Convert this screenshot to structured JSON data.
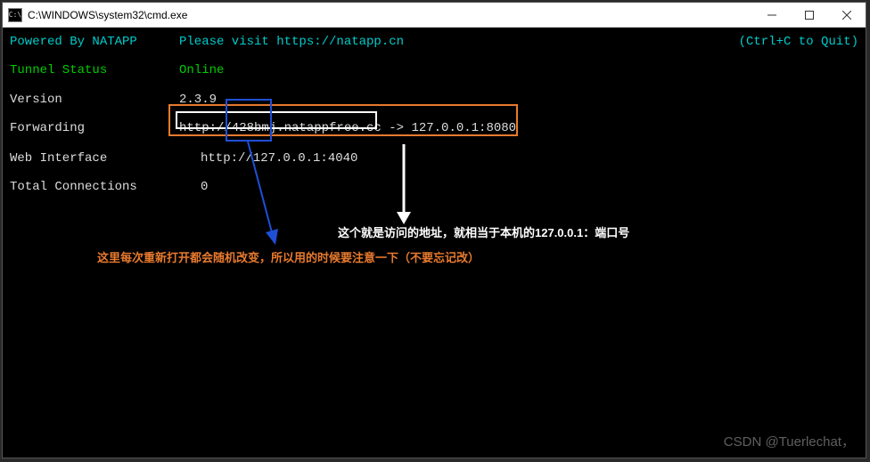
{
  "window": {
    "title": "C:\\WINDOWS\\system32\\cmd.exe",
    "icon_label": "C:\\"
  },
  "quit_hint": "(Ctrl+C to Quit)",
  "rows": {
    "powered": {
      "label": "Powered By NATAPP",
      "value": "Please visit https://natapp.cn"
    },
    "status": {
      "label": "Tunnel Status",
      "value": "Online"
    },
    "version": {
      "label": "Version",
      "value": "2.3.9"
    },
    "forwarding": {
      "label": "Forwarding",
      "url": "http://428bmj.natappfree.cc",
      "arrow": " -> 127.0.0.1:8080"
    },
    "web": {
      "label": "Web Interface",
      "value": "http://127.0.0.1:4040"
    },
    "conn": {
      "label": "Total Connections",
      "value": "0"
    }
  },
  "annotations": {
    "white_text": "这个就是访问的地址，就相当于本机的127.0.0.1：端口号",
    "orange_text": "这里每次重新打开都会随机改变，所以用的时候要注意一下（不要忘记改）"
  },
  "watermark": "CSDN @Tuerlechat，"
}
